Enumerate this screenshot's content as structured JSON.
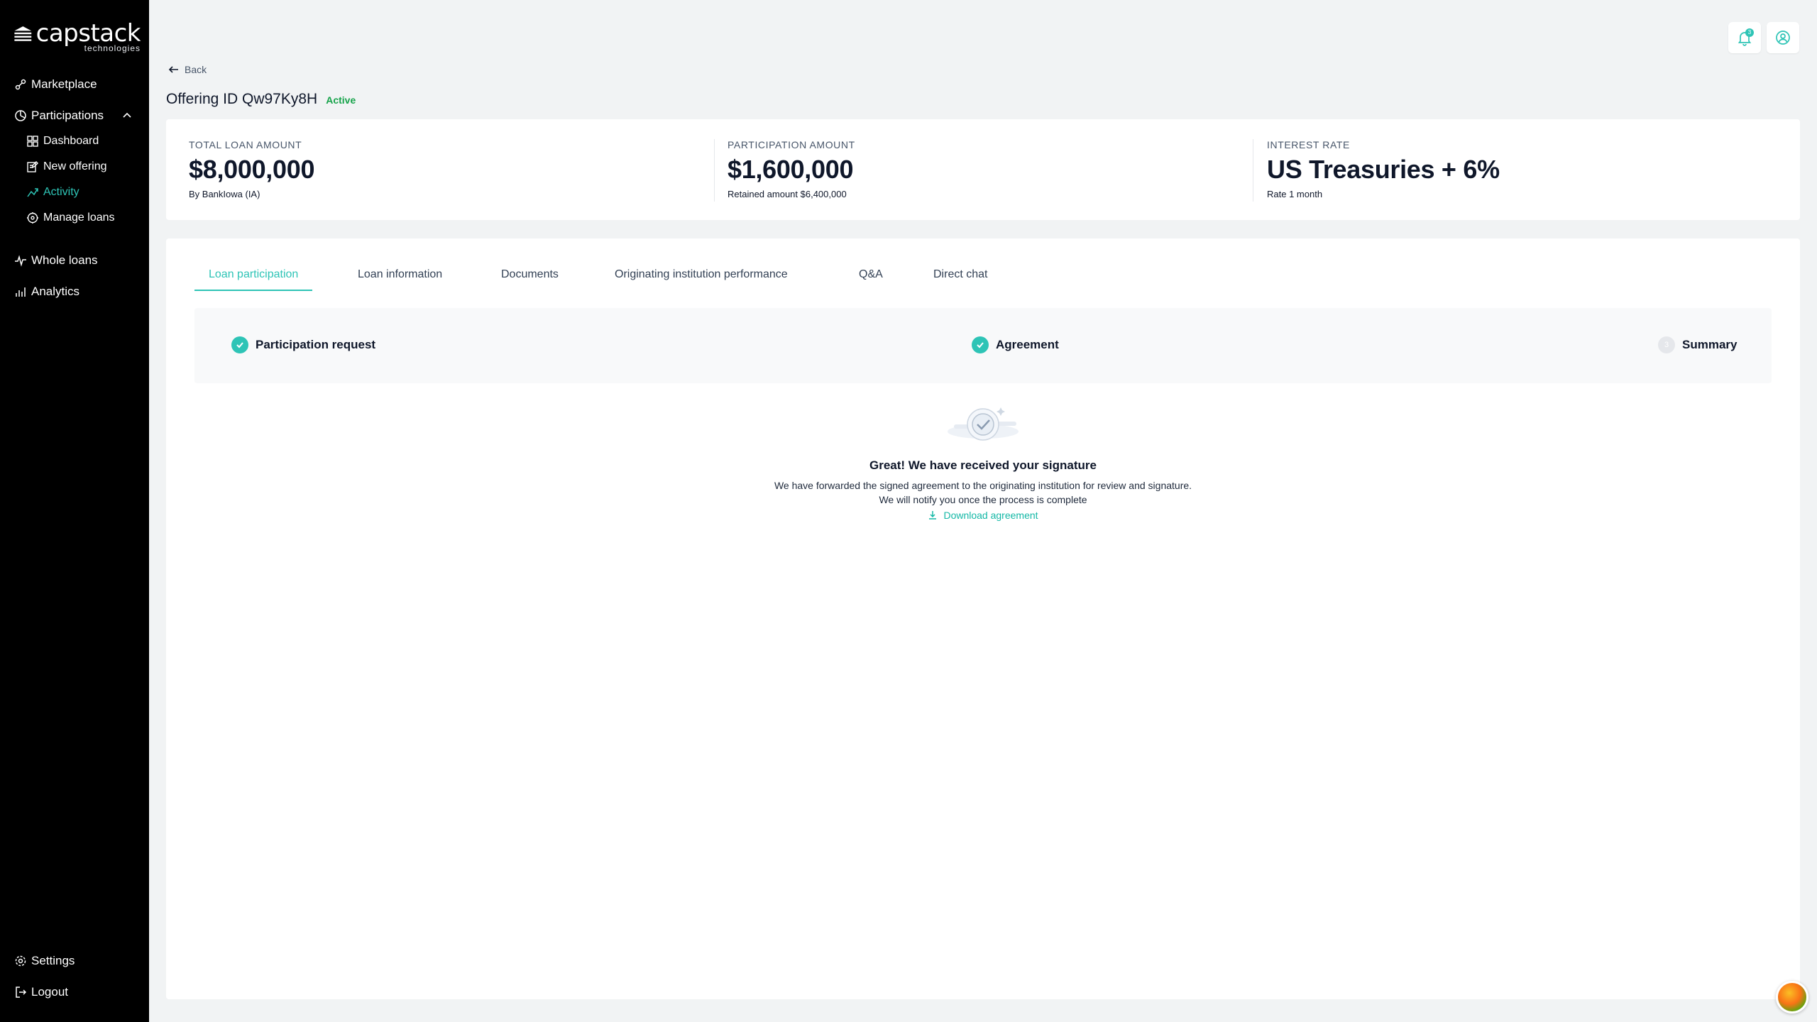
{
  "brand": {
    "name": "capstack",
    "sub": "technologies"
  },
  "sidebar": {
    "items": [
      {
        "label": "Marketplace",
        "icon": "marketplace-icon"
      },
      {
        "label": "Participations",
        "icon": "participations-icon",
        "expanded": true
      },
      {
        "label": "Dashboard",
        "icon": "dashboard-icon"
      },
      {
        "label": "New offering",
        "icon": "new-offering-icon"
      },
      {
        "label": "Activity",
        "icon": "activity-icon",
        "active": true
      },
      {
        "label": "Manage loans",
        "icon": "manage-loans-icon"
      },
      {
        "label": "Whole loans",
        "icon": "whole-loans-icon"
      },
      {
        "label": "Analytics",
        "icon": "analytics-icon"
      }
    ],
    "settings": "Settings",
    "logout": "Logout"
  },
  "header": {
    "back_label": "Back",
    "title": "Offering ID Qw97Ky8H",
    "status": "Active",
    "notification_count": "3"
  },
  "summary": {
    "total": {
      "label": "TOTAL LOAN AMOUNT",
      "value": "$8,000,000",
      "sub": "By BankIowa (IA)"
    },
    "participation": {
      "label": "PARTICIPATION AMOUNT",
      "value": "$1,600,000",
      "sub": "Retained amount $6,400,000"
    },
    "rate": {
      "label": "INTEREST RATE",
      "value": "US Treasuries + 6%",
      "sub": "Rate 1 month"
    }
  },
  "tabs": [
    "Loan participation",
    "Loan information",
    "Documents",
    "Originating institution performance",
    "Q&A",
    "Direct chat"
  ],
  "steps": [
    {
      "label": "Participation request",
      "done": true
    },
    {
      "label": "Agreement",
      "done": true
    },
    {
      "label": "Summary",
      "done": false,
      "number": "3"
    }
  ],
  "success": {
    "title": "Great! We have received your signature",
    "line1": "We have forwarded the signed agreement to the originating institution for review and signature.",
    "line2": "We will notify you once the process is complete",
    "download_label": "Download agreement"
  },
  "colors": {
    "accent": "#2ec4b6",
    "sidebar_bg": "#000000",
    "status_active": "#16a34a"
  }
}
